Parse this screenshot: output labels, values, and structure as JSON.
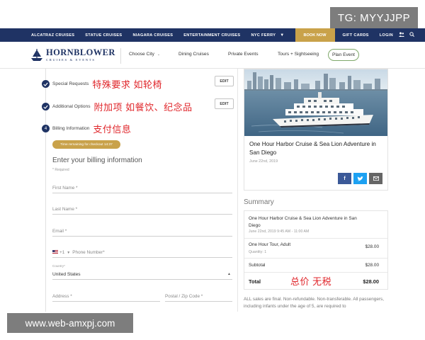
{
  "watermark": {
    "tag": "TG: MYYJJPP",
    "site": "www.web-amxpj.com"
  },
  "topnav": {
    "items": [
      "ALCATRAZ CRUISES",
      "STATUE CRUISES",
      "NIAGARA CRUISES",
      "ENTERTAINMENT CRUISES",
      "NYC FERRY"
    ],
    "book_now": "BOOK NOW",
    "gift_cards": "GIFT CARDS",
    "login": "LOGIN",
    "bg_color": "#1f3364",
    "accent_color": "#c9a24a"
  },
  "subnav": {
    "logo_name": "HORNBLOWER",
    "logo_sub": "CRUISES & EVENTS",
    "choose_city": "Choose City",
    "dining": "Dining Cruises",
    "private": "Private Events",
    "tours": "Tours + Sightseeing",
    "plan_event": "Plan Event"
  },
  "steps": [
    {
      "label": "Special Requests",
      "annotation": "特殊要求 如轮椅",
      "edit": "EDIT"
    },
    {
      "label": "Additional Options",
      "annotation": "附加项 如餐饮、纪念品",
      "edit": "EDIT"
    },
    {
      "number": "4",
      "label": "Billing Information",
      "annotation": "支付信息"
    }
  ],
  "checkout": {
    "timer": "Time remaining for checkout 14:37",
    "billing_title": "Enter your billing information",
    "required_note": "* Required",
    "first_name": "First Name *",
    "last_name": "Last Name *",
    "email": "Email *",
    "phone_code": "+1",
    "phone": "Phone Number*",
    "country_label": "Country*",
    "country_value": "United States",
    "address": "Address *",
    "postal": "Postal / Zip Code *"
  },
  "product": {
    "title": "One Hour Harbor Cruise & Sea Lion Adventure in San Diego",
    "date": "June 22nd, 2019"
  },
  "summary": {
    "heading": "Summary",
    "item_title": "One Hour Harbor Cruise & Sea Lion Adventure in San Diego",
    "item_datetime": "June 22nd, 2019 9:45 AM - 11:00 AM",
    "ticket_name": "One Hour Tour, Adult",
    "ticket_qty": "Quantity: 1",
    "ticket_price": "$28.00",
    "subtotal_label": "Subtotal",
    "subtotal": "$28.00",
    "total_label": "Total",
    "total": "$28.00",
    "total_annotation": "总价 无税",
    "disclaimer": "ALL sales are final. Non-refundable. Non-transferable. All passengers, including infants under the age of 5, are required to"
  }
}
